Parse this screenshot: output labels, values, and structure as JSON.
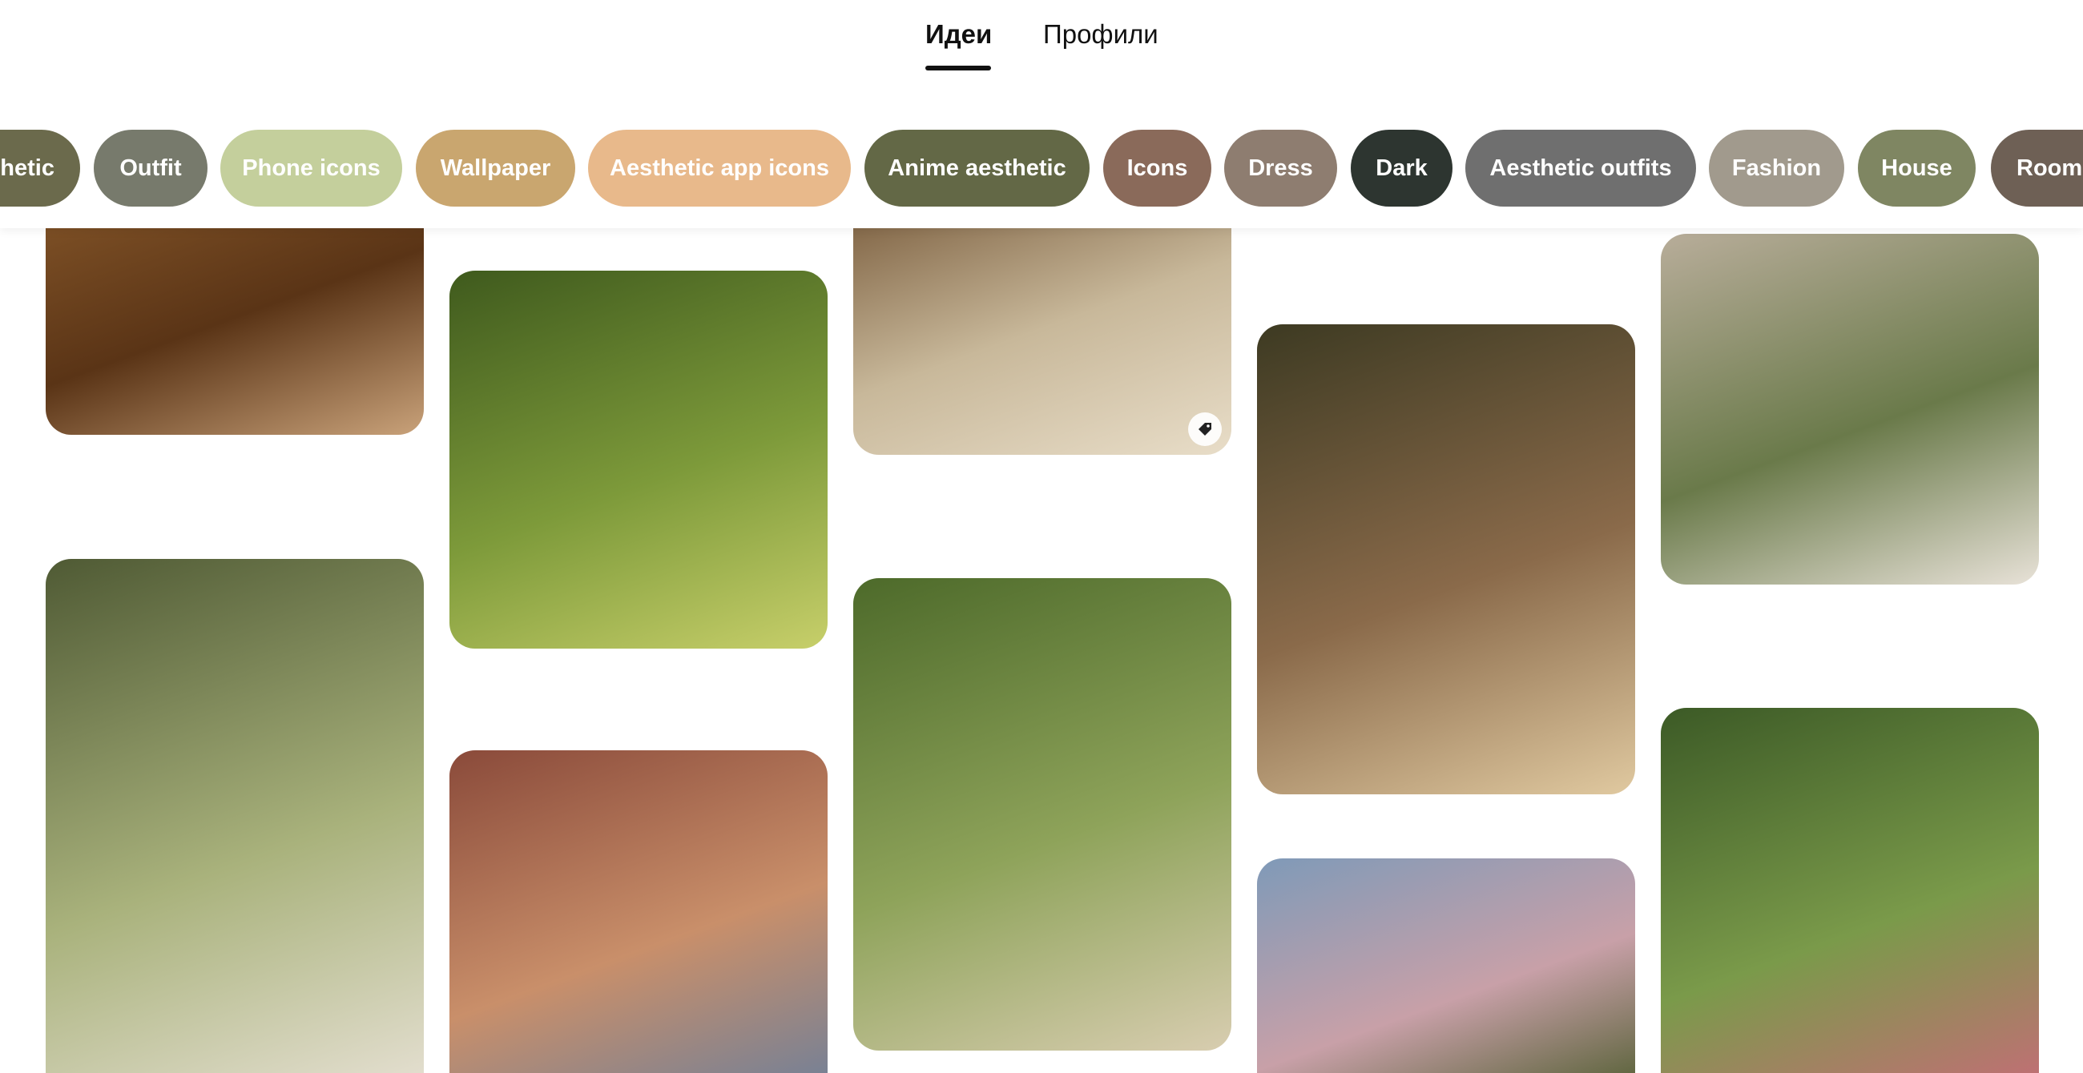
{
  "tabs": {
    "ideas": "Идеи",
    "profiles": "Профили",
    "active": "ideas"
  },
  "chips": [
    {
      "label": "Aesthetic",
      "color": "#6b6a4c"
    },
    {
      "label": "Outfit",
      "color": "#777a6c"
    },
    {
      "label": "Phone icons",
      "color": "#c4cf9c"
    },
    {
      "label": "Wallpaper",
      "color": "#c9a66f"
    },
    {
      "label": "Aesthetic app icons",
      "color": "#e8b98b"
    },
    {
      "label": "Anime aesthetic",
      "color": "#636846"
    },
    {
      "label": "Icons",
      "color": "#8a6a5a"
    },
    {
      "label": "Dress",
      "color": "#8e7d70"
    },
    {
      "label": "Dark",
      "color": "#2d3530"
    },
    {
      "label": "Aesthetic outfits",
      "color": "#6f6f6f"
    },
    {
      "label": "Fashion",
      "color": "#a19a8d"
    },
    {
      "label": "House",
      "color": "#7f8662"
    },
    {
      "label": "Room",
      "color": "#6e6055"
    }
  ],
  "pins": [
    {
      "name": "kitchen-apples",
      "colors": [
        "#8a5a2b",
        "#5a3416",
        "#c9a27a"
      ]
    },
    {
      "name": "white-cat-meadow",
      "colors": [
        "#4f5a34",
        "#a9b27c",
        "#e8e2d6"
      ]
    },
    {
      "name": "dandelion-meadow",
      "colors": [
        "#3f5a1d",
        "#7d9a3a",
        "#c7cf6a"
      ]
    },
    {
      "name": "picnic-hat-flowers",
      "colors": [
        "#8a4a3a",
        "#c98f6a",
        "#6d7f9a"
      ]
    },
    {
      "name": "books-candles-shelf",
      "colors": [
        "#6a4a2a",
        "#c8b89a",
        "#e8ddc8"
      ]
    },
    {
      "name": "open-window-desk",
      "colors": [
        "#4d6a2a",
        "#8ea35a",
        "#d8cdb0"
      ]
    },
    {
      "name": "cozy-plant-room",
      "colors": [
        "#3d3a22",
        "#8a6a4a",
        "#e0c9a0"
      ]
    },
    {
      "name": "sky-trees",
      "colors": [
        "#7f9ab8",
        "#c8a0a8",
        "#4a5a2a"
      ]
    },
    {
      "name": "window-kitchen-cats",
      "colors": [
        "#b8ad9a",
        "#6a7a4a",
        "#e8e2d8"
      ]
    },
    {
      "name": "fairytale-cottage-garden",
      "colors": [
        "#3c5a26",
        "#7a9a4a",
        "#c96a7a"
      ]
    }
  ]
}
